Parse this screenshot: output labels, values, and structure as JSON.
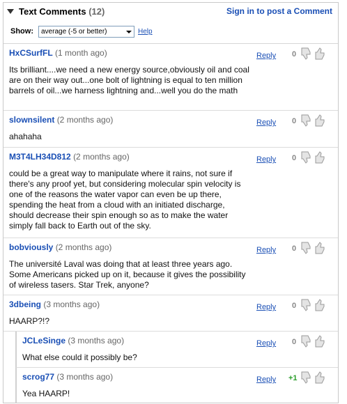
{
  "header": {
    "title": "Text Comments",
    "count": "(12)",
    "signin_label": "Sign in to post a Comment",
    "show_label": "Show:",
    "show_value": "average (-5 or better)",
    "help_label": "Help"
  },
  "reply_label": "Reply",
  "icons": {
    "toggle": "triangle-down-icon",
    "down": "thumb-down-icon",
    "up": "thumb-up-icon"
  },
  "colors": {
    "link": "#1a4fb5",
    "positive": "#2a9d2a"
  },
  "comments": [
    {
      "author": "HxCSurfFL",
      "time": "(1 month ago)",
      "score": "0",
      "text": "Its brilliant....we need a new energy source,obviously oil and coal are on their way out...one bolt of lightning is equal to ten million barrels of oil...we harness lightning and...well you do the math"
    },
    {
      "author": "slownsilent",
      "time": "(2 months ago)",
      "score": "0",
      "text": "ahahaha"
    },
    {
      "author": "M3T4LH34D812",
      "time": "(2 months ago)",
      "score": "0",
      "text": "could be a great way to manipulate where it rains, not sure if there's any proof yet, but considering molecular spin velocity is one of the reasons the water vapor can even be up there, spending the heat from a cloud with an initiated discharge, should decrease their spin enough so as to make the water simply fall back to Earth out of the sky."
    },
    {
      "author": "bobviously",
      "time": "(2 months ago)",
      "score": "0",
      "text": "The université Laval was doing that at least three years ago. Some Americans picked up on it, because it gives the possibility of wireless tasers. Star Trek, anyone?"
    },
    {
      "author": "3dbeing",
      "time": "(3 months ago)",
      "score": "0",
      "text": "HAARP?!?"
    },
    {
      "author": "JCLeSinge",
      "time": "(3 months ago)",
      "score": "0",
      "text": "What else could it possibly be?"
    },
    {
      "author": "scrog77",
      "time": "(3 months ago)",
      "score": "+1",
      "text": "Yea HAARP!"
    }
  ]
}
